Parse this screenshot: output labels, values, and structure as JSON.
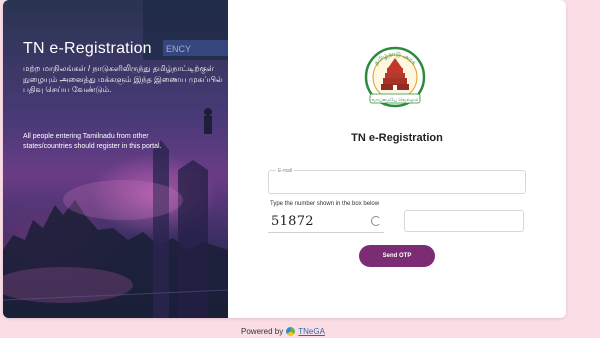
{
  "left_panel": {
    "title": "TN e-Registration",
    "tamil_text": "மற்ற மாநிலங்கள் / நாடுகளிலிருந்து தமிழ்நாட்டிற்குள் நுழையும் அனைத்து மக்களும் இந்த இணைய முகப்பில் பதிவு செய்ய வேண்டும்.",
    "english_text": "All people entering Tamilnadu from other states/countries should register in this portal.",
    "banner_text": "ENCY"
  },
  "form": {
    "emblem_top_text": "தமிழ்நாடு அரசு",
    "emblem_bottom_text": "வாய்மையே வெல்லும்",
    "title": "TN e-Registration",
    "email_label": "E-mail",
    "captcha_label": "Type the number shown in the box below",
    "captcha_value": "51872",
    "send_button": "Send OTP"
  },
  "footer": {
    "powered_by": "Powered by",
    "link": "TNeGA"
  },
  "colors": {
    "page_background": "#fbdde6",
    "button": "#7b2c74",
    "link": "#2b6cb0"
  },
  "icons": [
    "refresh-icon",
    "tnega-logo-icon",
    "tamilnadu-emblem-icon"
  ]
}
